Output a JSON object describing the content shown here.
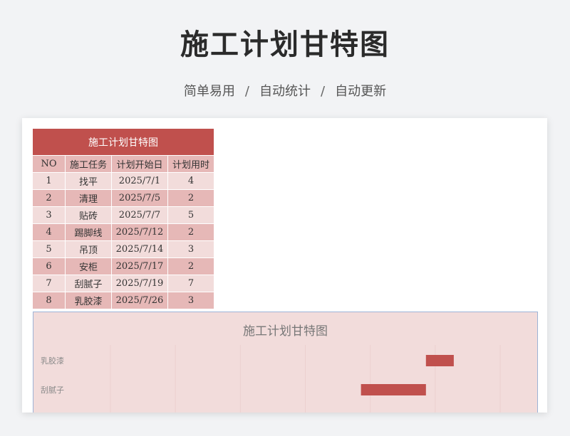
{
  "page": {
    "title": "施工计划甘特图",
    "subtitle": [
      "简单易用",
      "自动统计",
      "自动更新"
    ],
    "separator": "/"
  },
  "table": {
    "title": "施工计划甘特图",
    "headers": [
      "NO",
      "施工任务",
      "计划开始日",
      "计划用时"
    ],
    "rows": [
      [
        "1",
        "找平",
        "2025/7/1",
        "4"
      ],
      [
        "2",
        "清理",
        "2025/7/5",
        "2"
      ],
      [
        "3",
        "贴砖",
        "2025/7/7",
        "5"
      ],
      [
        "4",
        "踢脚线",
        "2025/7/12",
        "2"
      ],
      [
        "5",
        "吊顶",
        "2025/7/14",
        "3"
      ],
      [
        "6",
        "安柜",
        "2025/7/17",
        "2"
      ],
      [
        "7",
        "刮腻子",
        "2025/7/19",
        "7"
      ],
      [
        "8",
        "乳胶漆",
        "2025/7/26",
        "3"
      ]
    ]
  },
  "chart_data": {
    "type": "bar",
    "orientation": "horizontal-stacked-gantt",
    "title": "施工计划甘特图",
    "categories": [
      "乳胶漆",
      "刮腻子"
    ],
    "series": [
      {
        "values": [
          "2025/7/26",
          "2025/7/19"
        ]
      },
      {
        "values": [
          3,
          7
        ]
      }
    ],
    "x_start": "2025/6/22",
    "x_end": "2025/8/3",
    "bar_color": "#c0504d",
    "grid": "vertical, faint"
  }
}
